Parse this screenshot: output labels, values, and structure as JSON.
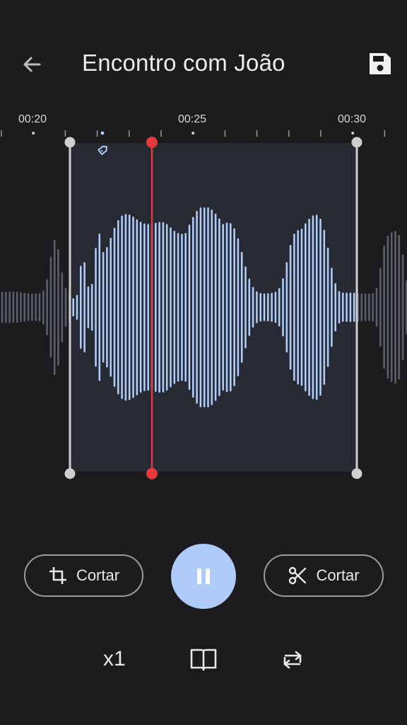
{
  "header": {
    "title": "Encontro com João",
    "back_icon": "arrow-back-icon",
    "save_icon": "save-icon"
  },
  "timeline": {
    "labels": [
      "00:20",
      "00:25",
      "00:30"
    ]
  },
  "waveform": {
    "playhead_color": "#e5393b",
    "wave_color_selected": "#aecbfa",
    "wave_color_unselected": "#5a5f6b",
    "selection_bg": "#272a33",
    "marker_icon": "label-tag-icon"
  },
  "controls": {
    "trim_label": "Cortar",
    "trim_icon": "crop-icon",
    "cut_label": "Cortar",
    "cut_icon": "scissors-icon",
    "play_state_icon": "pause-icon",
    "accent": "#aecbfa"
  },
  "bottom": {
    "speed": "x1",
    "book_icon": "book-icon",
    "loop_icon": "repeat-icon"
  }
}
